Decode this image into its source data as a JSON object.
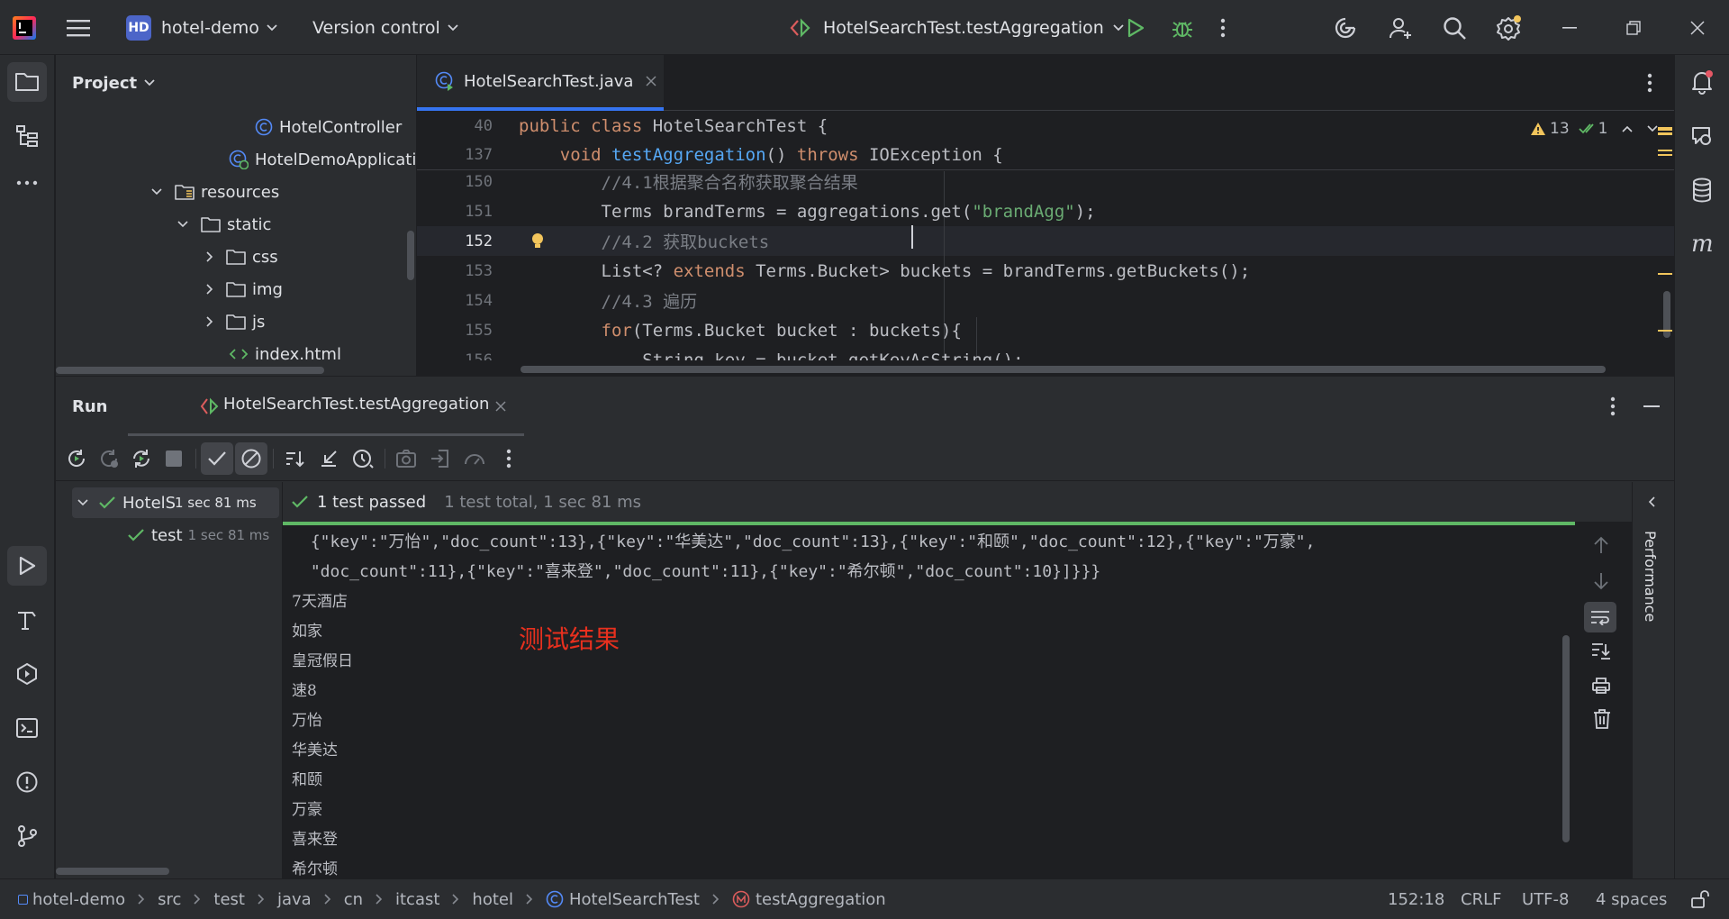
{
  "titlebar": {
    "project_badge": "HD",
    "project_name": "hotel-demo",
    "vcs_label": "Version control",
    "run_config": "HotelSearchTest.testAggregation"
  },
  "project_panel": {
    "title": "Project",
    "tree": [
      {
        "label": "HotelController",
        "type": "class"
      },
      {
        "label": "HotelDemoApplication",
        "type": "springclass"
      },
      {
        "label": "resources",
        "type": "folder"
      },
      {
        "label": "static",
        "type": "folder"
      },
      {
        "label": "css",
        "type": "folder"
      },
      {
        "label": "img",
        "type": "folder"
      },
      {
        "label": "js",
        "type": "folder"
      },
      {
        "label": "index.html",
        "type": "html"
      }
    ]
  },
  "editor": {
    "tab_label": "HotelSearchTest.java",
    "warnings_count": "13",
    "ok_count": "1",
    "sticky": [
      {
        "num": "40",
        "segments": [
          {
            "t": "public class ",
            "c": "kw"
          },
          {
            "t": "HotelSearchTest {",
            "c": "plain"
          }
        ]
      },
      {
        "num": "137",
        "segments": [
          {
            "t": "    void ",
            "c": "kw"
          },
          {
            "t": "testAggregation",
            "c": "fn"
          },
          {
            "t": "() ",
            "c": "plain"
          },
          {
            "t": "throws ",
            "c": "kw"
          },
          {
            "t": "IOException {",
            "c": "plain"
          }
        ]
      }
    ],
    "lines": [
      {
        "num": "150",
        "segments": [
          {
            "t": "        //4.1根据聚合名称获取聚合结果",
            "c": "cm"
          }
        ]
      },
      {
        "num": "151",
        "segments": [
          {
            "t": "        Terms brandTerms = aggregations.get(",
            "c": "plain"
          },
          {
            "t": "\"brandAgg\"",
            "c": "str"
          },
          {
            "t": ");",
            "c": "plain"
          }
        ]
      },
      {
        "num": "152",
        "segments": [
          {
            "t": "        //4.2 获取buckets",
            "c": "cm"
          }
        ]
      },
      {
        "num": "153",
        "segments": [
          {
            "t": "        List<? ",
            "c": "plain"
          },
          {
            "t": "extends ",
            "c": "kw"
          },
          {
            "t": "Terms.Bucket> buckets = brandTerms.getBuckets();",
            "c": "plain"
          }
        ]
      },
      {
        "num": "154",
        "segments": [
          {
            "t": "        //4.3 遍历",
            "c": "cm"
          }
        ]
      },
      {
        "num": "155",
        "segments": [
          {
            "t": "        ",
            "c": "plain"
          },
          {
            "t": "for",
            "c": "kw"
          },
          {
            "t": "(Terms.Bucket bucket : buckets){",
            "c": "plain"
          }
        ]
      },
      {
        "num": "156",
        "segments": [
          {
            "t": "            String key = bucket.getKeyAsString();",
            "c": "plain"
          }
        ]
      }
    ]
  },
  "run_panel": {
    "title": "Run",
    "tab_label": "HotelSearchTest.testAggregation",
    "test_tree": [
      {
        "label": "HotelS",
        "time": "1 sec 81 ms"
      },
      {
        "label": "test",
        "time": "1 sec 81 ms"
      }
    ],
    "status": {
      "passed": "1 test passed",
      "summary": "1 test total, 1 sec 81 ms"
    },
    "console_json": [
      " {\"key\":\"万怡\",\"doc_count\":13},{\"key\":\"华美达\",\"doc_count\":13},{\"key\":\"和颐\",\"doc_count\":12},{\"key\":\"万豪\",",
      " \"doc_count\":11},{\"key\":\"喜来登\",\"doc_count\":11},{\"key\":\"希尔顿\",\"doc_count\":10}]}}}"
    ],
    "console_lines": [
      "7天酒店",
      "如家",
      "皇冠假日",
      "速8",
      "万怡",
      "华美达",
      "和颐",
      "万豪",
      "喜来登",
      "希尔顿"
    ],
    "annotation": "测试结果",
    "annotation_color": "#e8301e",
    "side_tab": "Performance"
  },
  "statusbar": {
    "breadcrumbs": [
      "hotel-demo",
      "src",
      "test",
      "java",
      "cn",
      "itcast",
      "hotel",
      "HotelSearchTest",
      "testAggregation"
    ],
    "position": "152:18",
    "line_sep": "CRLF",
    "encoding": "UTF-8",
    "indent": "4 spaces"
  },
  "colors": {
    "accent": "#3574f0",
    "run_green": "#5fb865",
    "keyword": "#cf8e6d",
    "function": "#56a8f5",
    "string": "#6aab73",
    "comment": "#7a7e85"
  }
}
